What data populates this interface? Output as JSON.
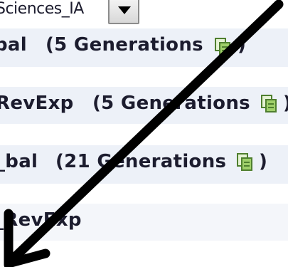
{
  "scope": {
    "label": "Sciences_IA"
  },
  "rows": [
    {
      "name": "bal",
      "generations": "(5 Generations",
      "close": ")"
    },
    {
      "name": "RevExp",
      "generations": "(5 Generations",
      "close": ")"
    },
    {
      "name": "_bal",
      "generations": "(21 Generations",
      "close": ")"
    },
    {
      "name": "_RevExp"
    }
  ],
  "icons": {
    "dropdown": "chevron-down-icon",
    "generations": "generations-icon",
    "arrow": "arrow-annotation"
  },
  "colors": {
    "row_background": "#edf1f8",
    "text": "#1c1c2e",
    "icon_green": "#9fcf6a"
  }
}
